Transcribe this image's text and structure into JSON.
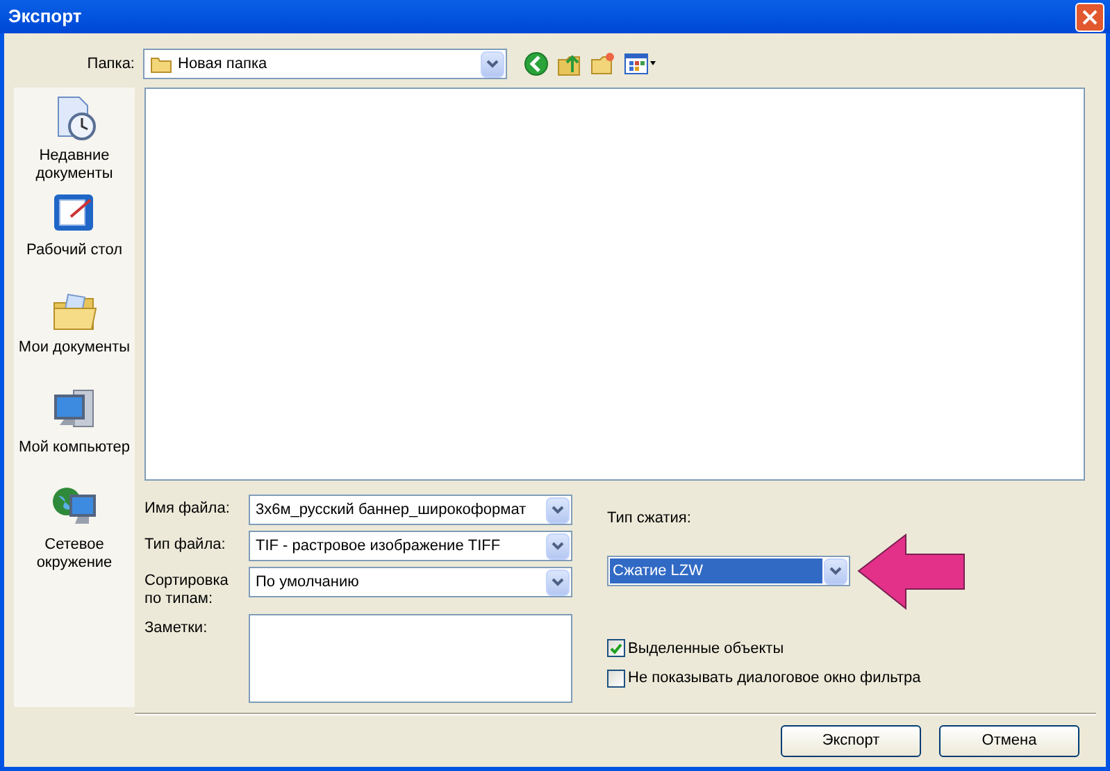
{
  "window": {
    "title": "Экспорт"
  },
  "folder": {
    "label": "Папка:",
    "value": "Новая папка"
  },
  "places": [
    {
      "label": "Недавние документы"
    },
    {
      "label": "Рабочий стол"
    },
    {
      "label": "Мои документы"
    },
    {
      "label": "Мой компьютер"
    },
    {
      "label": "Сетевое окружение"
    }
  ],
  "form": [
    {
      "label": "Имя файла:",
      "value": "3х6м_русский баннер_широкоформат",
      "kind": "combo"
    },
    {
      "label": "Тип файла:",
      "value": "TIF - растровое изображение TIFF",
      "kind": "combo"
    },
    {
      "label": "Сортировка по типам:",
      "value": "По умолчанию",
      "kind": "combo"
    },
    {
      "label": "Заметки:",
      "kind": "memo"
    }
  ],
  "compression": {
    "label": "Тип сжатия:",
    "value": "Сжатие LZW",
    "focused": true
  },
  "options": [
    {
      "label": "Выделенные объекты",
      "checked": true
    },
    {
      "label": "Не показывать диалоговое окно фильтра",
      "checked": false
    }
  ],
  "buttons": [
    "Экспорт",
    "Отмена"
  ]
}
